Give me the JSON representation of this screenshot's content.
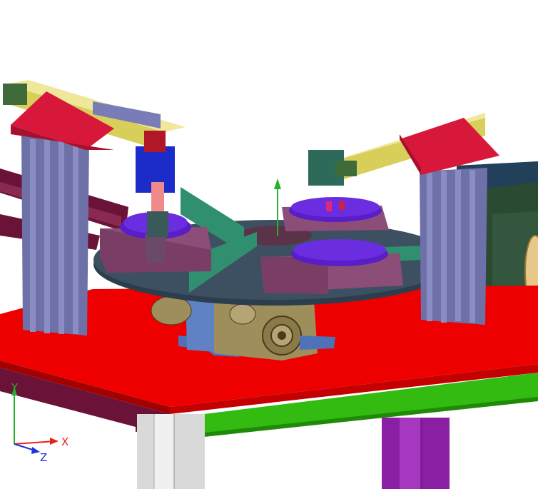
{
  "viewport": {
    "background": "#ffffff",
    "scene": "cad-assembly-rotary-indexing-table"
  },
  "axis_triad": {
    "x_label": "X",
    "y_label": "Y",
    "z_label": "Z",
    "x_color": "#e8221b",
    "y_color": "#27b02a",
    "z_color": "#2233d6"
  },
  "colors": {
    "table_top": "#ee0000",
    "table_edge": "#a30000",
    "table_front_green": "#33bb11",
    "leg_grey": "#cfcfcf",
    "leg_purple": "#8a1fa3",
    "frame_maroon": "#6b1238",
    "column_slate": "#6e70a8",
    "bracket_red": "#d8183a",
    "rail_yellow": "#d8cf5a",
    "turntable_dark": "#2c3d4d",
    "fixture_mauve": "#8c4d78",
    "fixture_violet": "#5a1ec9",
    "gearbox_bronze": "#9e8e5c",
    "gearbox_blue": "#4e72b8",
    "divider_green": "#2f8f6f"
  }
}
